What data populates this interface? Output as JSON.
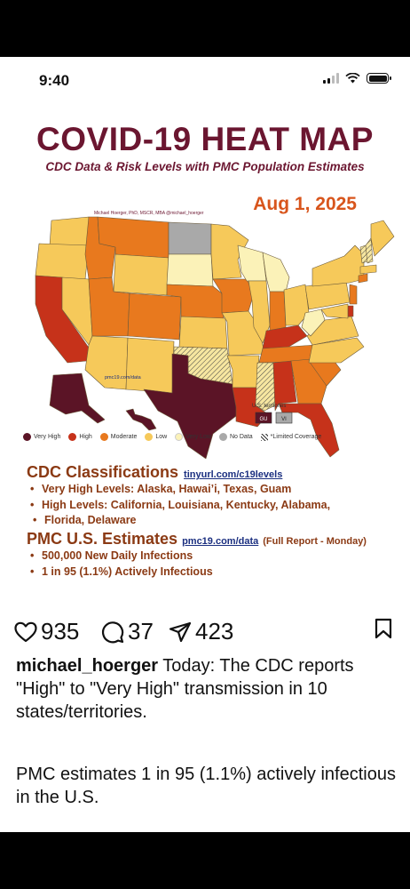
{
  "status_bar": {
    "time": "9:40"
  },
  "post": {
    "map": {
      "title": "COVID-19 HEAT MAP",
      "subtitle": "CDC Data & Risk Levels with PMC Population Estimates",
      "date": "Aug 1, 2025",
      "author": "Michael Hoerger, PhD, MSCR, MBA @michael_hoerger",
      "source_link": "pmc19.com/data",
      "territories_label": "U.S. territories",
      "territory_gu": "GU",
      "territory_vi": "VI",
      "colors": {
        "very_high": "#5b1426",
        "high": "#c6321a",
        "moderate": "#e8791e",
        "low": "#f6c95a",
        "very_low": "#fbf2b8",
        "no_data": "#a9a9a9"
      },
      "legend": [
        "Very High",
        "High",
        "Moderate",
        "Low",
        "Very Low",
        "No Data",
        "*Limited Coverage"
      ]
    },
    "cdc": {
      "heading": "CDC Classifications",
      "link": "tinyurl.com/c19levels",
      "very_high": "Very High Levels: Alaska, Hawai’i, Texas, Guam",
      "high_line1": "High Levels: California, Louisiana, Kentucky, Alabama,",
      "high_line2": "Florida, Delaware"
    },
    "pmc": {
      "heading": "PMC U.S. Estimates",
      "link": "pmc19.com/data",
      "note": "(Full Report - Monday)",
      "bullet1": "500,000 New Daily Infections",
      "bullet2": "1 in 95 (1.1%) Actively Infectious"
    }
  },
  "actions": {
    "likes": "935",
    "comments": "37",
    "shares": "423"
  },
  "caption": {
    "username": "michael_hoerger",
    "text": "Today: The CDC reports \"High\" to \"Very High\" transmission in 10 states/territories.",
    "text2": "PMC estimates 1 in 95 (1.1%) actively infectious in the U.S."
  }
}
